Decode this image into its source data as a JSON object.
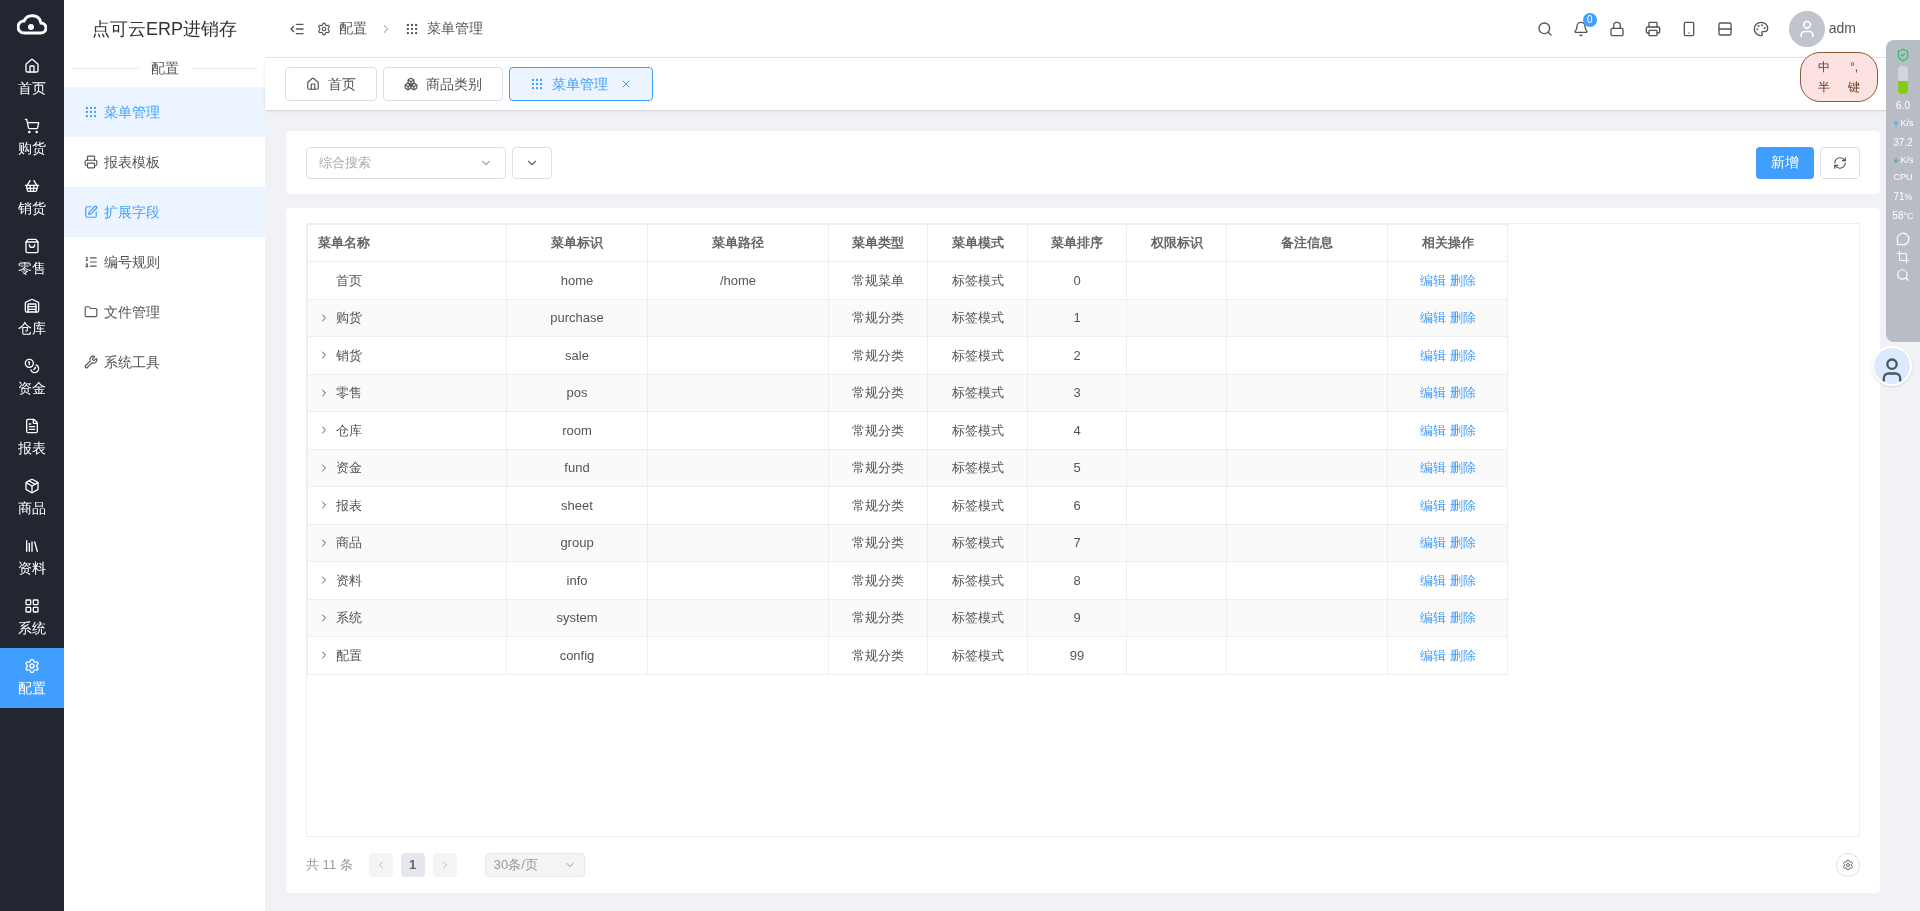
{
  "app_nav": [
    {
      "label": "首页",
      "selected": false
    },
    {
      "label": "购货",
      "selected": false
    },
    {
      "label": "销货",
      "selected": false
    },
    {
      "label": "零售",
      "selected": false
    },
    {
      "label": "仓库",
      "selected": false
    },
    {
      "label": "资金",
      "selected": false
    },
    {
      "label": "报表",
      "selected": false
    },
    {
      "label": "商品",
      "selected": false
    },
    {
      "label": "资料",
      "selected": false
    },
    {
      "label": "系统",
      "selected": false
    },
    {
      "label": "配置",
      "selected": true
    }
  ],
  "brand": "点可云ERP进销存",
  "section_title": "配置",
  "sub_menu": [
    {
      "label": "菜单管理",
      "selected": true
    },
    {
      "label": "报表模板",
      "selected": false
    },
    {
      "label": "扩展字段",
      "selected": true
    },
    {
      "label": "编号规则",
      "selected": false
    },
    {
      "label": "文件管理",
      "selected": false
    },
    {
      "label": "系统工具",
      "selected": false
    }
  ],
  "breadcrumb": [
    "配置",
    "菜单管理"
  ],
  "header": {
    "notification_count": "0",
    "user": "adm"
  },
  "ime_badge": [
    "中",
    "°,",
    "半",
    "键"
  ],
  "page_tabs": [
    {
      "label": "首页",
      "selected": false,
      "closable": false
    },
    {
      "label": "商品类别",
      "selected": false,
      "closable": false
    },
    {
      "label": "菜单管理",
      "selected": true,
      "closable": true
    }
  ],
  "search": {
    "placeholder": "综合搜索"
  },
  "add_button": "新增",
  "table": {
    "columns": [
      "菜单名称",
      "菜单标识",
      "菜单路径",
      "菜单类型",
      "菜单模式",
      "菜单排序",
      "权限标识",
      "备注信息",
      "相关操作"
    ],
    "rows": [
      {
        "name": "首页",
        "expandable": false,
        "key": "home",
        "path": "/home",
        "type": "常规菜单",
        "mode": "标签模式",
        "order": "0",
        "actions": [
          "编辑",
          "删除"
        ]
      },
      {
        "name": "购货",
        "expandable": true,
        "key": "purchase",
        "type": "常规分类",
        "mode": "标签模式",
        "order": "1",
        "actions": [
          "编辑",
          "删除"
        ]
      },
      {
        "name": "销货",
        "expandable": true,
        "key": "sale",
        "type": "常规分类",
        "mode": "标签模式",
        "order": "2",
        "actions": [
          "编辑",
          "删除"
        ]
      },
      {
        "name": "零售",
        "expandable": true,
        "key": "pos",
        "type": "常规分类",
        "mode": "标签模式",
        "order": "3",
        "actions": [
          "编辑",
          "删除"
        ]
      },
      {
        "name": "仓库",
        "expandable": true,
        "key": "room",
        "type": "常规分类",
        "mode": "标签模式",
        "order": "4",
        "actions": [
          "编辑",
          "删除"
        ]
      },
      {
        "name": "资金",
        "expandable": true,
        "key": "fund",
        "type": "常规分类",
        "mode": "标签模式",
        "order": "5",
        "actions": [
          "编辑",
          "删除"
        ]
      },
      {
        "name": "报表",
        "expandable": true,
        "key": "sheet",
        "type": "常规分类",
        "mode": "标签模式",
        "order": "6",
        "actions": [
          "编辑",
          "删除"
        ]
      },
      {
        "name": "商品",
        "expandable": true,
        "key": "group",
        "type": "常规分类",
        "mode": "标签模式",
        "order": "7",
        "actions": [
          "编辑",
          "删除"
        ]
      },
      {
        "name": "资料",
        "expandable": true,
        "key": "info",
        "type": "常规分类",
        "mode": "标签模式",
        "order": "8",
        "actions": [
          "编辑",
          "删除"
        ]
      },
      {
        "name": "系统",
        "expandable": true,
        "key": "system",
        "type": "常规分类",
        "mode": "标签模式",
        "order": "9",
        "actions": [
          "编辑",
          "删除"
        ]
      },
      {
        "name": "配置",
        "expandable": true,
        "key": "config",
        "type": "常规分类",
        "mode": "标签模式",
        "order": "99",
        "actions": [
          "编辑",
          "删除"
        ]
      }
    ]
  },
  "pagination": {
    "total": "共 11 条",
    "pages": [
      {
        "label": "1",
        "selected": true
      }
    ],
    "page_size": "30条/页"
  },
  "monitor": {
    "up": "6.0",
    "up_unit": "K/s",
    "down": "37.2",
    "down_unit": "K/s",
    "cpu_label": "CPU",
    "cpu": "71",
    "cpu_unit": "%",
    "temp": "58",
    "temp_unit": "°C",
    "battery": {
      "level": 0.45
    }
  }
}
